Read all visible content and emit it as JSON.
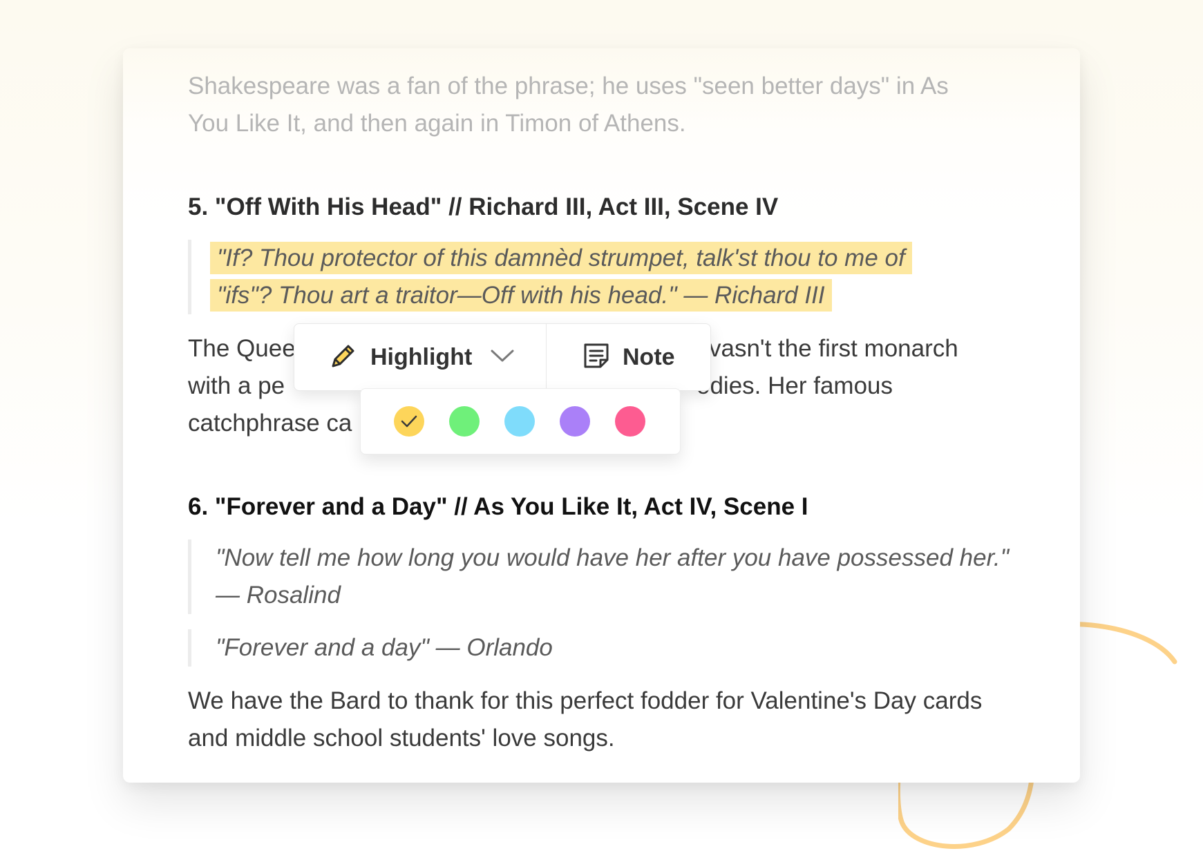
{
  "article": {
    "intro_paragraph": "Shakespeare was a fan of the phrase; he uses \"seen better days\" in As You Like It, and then again in Timon of Athens.",
    "section5": {
      "heading": "5. \"Off With His Head\" // Richard III, Act III, Scene IV",
      "quote_line1": "\"If? Thou protector of this damnèd strumpet, talk'st thou to me of",
      "quote_line2": "\"ifs\"? Thou art a traitor—Off with his head.\" — Richard III",
      "para_line1_start": "The Quee",
      "para_line1_end": "vasn't the first monarch",
      "para_line2_start": "with a pe",
      "para_line2_end": "odies. Her famous",
      "para_line3_start": "catchphrase ca"
    },
    "section6": {
      "heading": "6. \"Forever and a Day\" // As You Like It, Act IV, Scene I",
      "quote1": "\"Now tell me how long you would have her after you have possessed her.\" — Rosalind",
      "quote2": "\"Forever and a day\" — Orlando",
      "paragraph": "We have the Bard to thank for this perfect fodder for Valentine's Day cards and middle school students' love songs."
    }
  },
  "toolbar": {
    "highlight_label": "Highlight",
    "highlight_icon": "pencil-icon",
    "dropdown_icon": "chevron-down-icon",
    "note_label": "Note",
    "note_icon": "note-icon"
  },
  "palette": {
    "selected": "yellow",
    "colors": [
      {
        "name": "yellow",
        "hex": "#fdd55a"
      },
      {
        "name": "green",
        "hex": "#6ff07a"
      },
      {
        "name": "blue",
        "hex": "#7fdcfb"
      },
      {
        "name": "purple",
        "hex": "#aa80f8"
      },
      {
        "name": "pink",
        "hex": "#fd5c91"
      }
    ]
  },
  "colors": {
    "highlight_bg": "#fde8a1",
    "scribble": "#fdd289"
  }
}
